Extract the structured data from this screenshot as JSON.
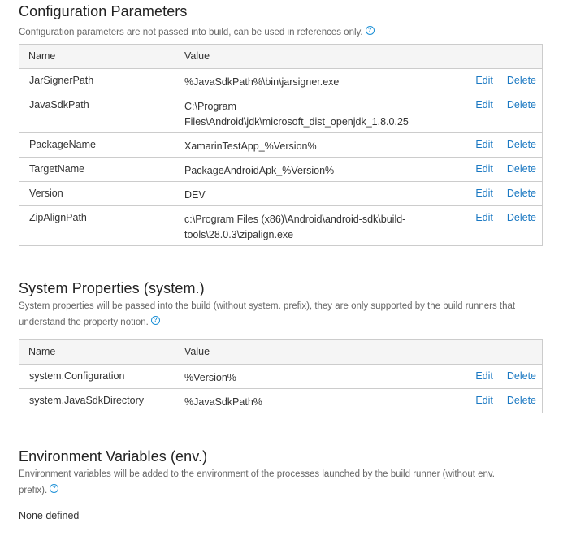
{
  "config": {
    "title": "Configuration Parameters",
    "description": "Configuration parameters are not passed into build, can be used in references only.",
    "columns": {
      "name": "Name",
      "value": "Value"
    },
    "rows": [
      {
        "name": "JarSignerPath",
        "value": "%JavaSdkPath%\\bin\\jarsigner.exe"
      },
      {
        "name": "JavaSdkPath",
        "value_line1": "C:\\Program",
        "value_line2": "Files\\Android\\jdk\\microsoft_dist_openjdk_1.8.0.25"
      },
      {
        "name": "PackageName",
        "value": "XamarinTestApp_%Version%"
      },
      {
        "name": "TargetName",
        "value": "PackageAndroidApk_%Version%"
      },
      {
        "name": "Version",
        "value": "DEV"
      },
      {
        "name": "ZipAlignPath",
        "value_line1": "c:\\Program Files (x86)\\Android\\android-sdk\\build-",
        "value_line2": "tools\\28.0.3\\zipalign.exe"
      }
    ]
  },
  "system": {
    "title": "System Properties (system.)",
    "description_line1": "System properties will be passed into the build (without system. prefix), they are only supported by the build runners that",
    "description_line2": "understand the property notion.",
    "columns": {
      "name": "Name",
      "value": "Value"
    },
    "rows": [
      {
        "name": "system.Configuration",
        "value": "%Version%"
      },
      {
        "name": "system.JavaSdkDirectory",
        "value": "%JavaSdkPath%"
      }
    ]
  },
  "env": {
    "title": "Environment Variables (env.)",
    "description_line1": "Environment variables will be added to the environment of the processes launched by the build runner (without env.",
    "description_line2": "prefix).",
    "empty_text": "None defined"
  },
  "actions": {
    "edit": "Edit",
    "delete": "Delete"
  },
  "help_glyph": "?",
  "colors": {
    "link": "#1a78c2",
    "help": "#1a8fd6",
    "header_bg": "#f5f5f5",
    "border": "#cccccc"
  }
}
